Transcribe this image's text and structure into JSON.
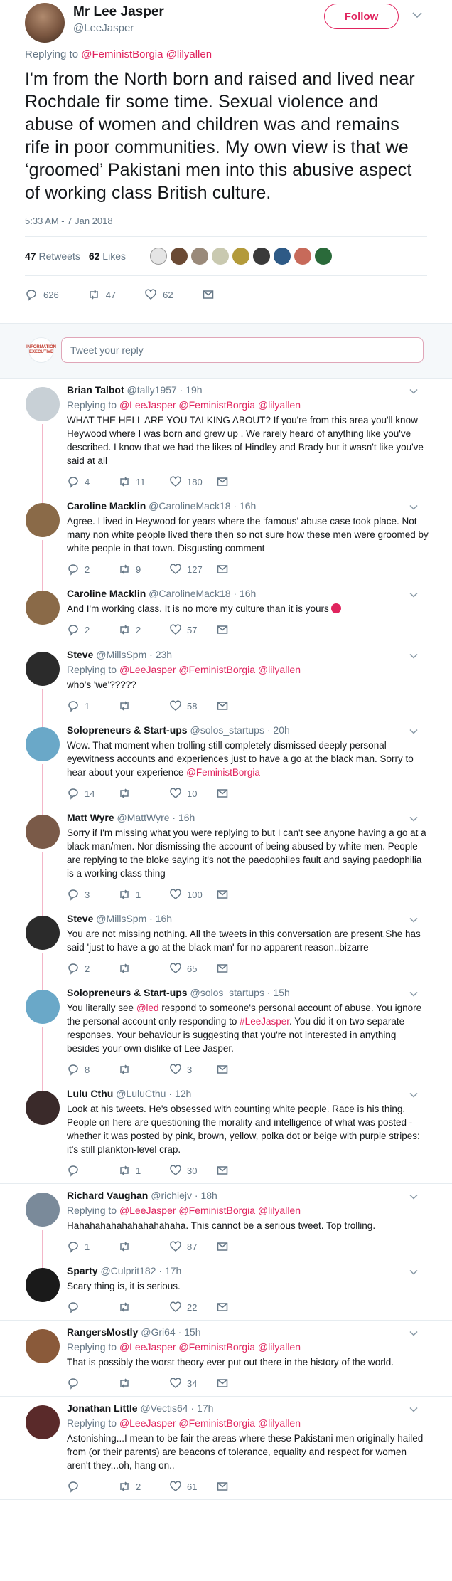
{
  "main": {
    "name": "Mr Lee Jasper",
    "handle": "@LeeJasper",
    "follow_label": "Follow",
    "replying_prefix": "Replying to",
    "replying_to": "@FeministBorgia @lilyallen",
    "text": "I'm from the North born and raised and lived near Rochdale fir some time. Sexual violence and abuse of women and children was and remains rife in poor communities. My own view is that we ‘groomed’ Pakistani men into this abusive aspect of working class British culture.",
    "time": "5:33 AM - 7 Jan 2018",
    "retweets_count": "47",
    "retweets_label": "Retweets",
    "likes_count": "62",
    "likes_label": "Likes",
    "reply_count": "626",
    "retweet_count": "47",
    "like_count": "62"
  },
  "reply_box": {
    "placeholder": "Tweet your reply",
    "avatar_text": "INFORMATION EXECUTIVE"
  },
  "colors": {
    "accent": "#e0245e",
    "thread_line": "#f3b6c8",
    "muted": "#657786"
  },
  "replies": [
    {
      "name": "Brian Talbot",
      "handle": "@tally1957",
      "time": "· 19h",
      "replying": "@LeeJasper @FeministBorgia @lilyallen",
      "text": "WHAT THE HELL ARE YOU TALKING ABOUT? If you're from this area you'll know Heywood where I was born and grew up . We rarely heard of anything like you've described. I know that we had the likes of Hindley and Brady but it wasn't like you've said at all",
      "r": "4",
      "rt": "11",
      "l": "180"
    },
    {
      "name": "Caroline Macklin",
      "handle": "@CarolineMack18",
      "time": "· 16h",
      "replying": "",
      "text": "Agree. I lived in Heywood for years where the ‘famous’ abuse case took place. Not many non white people lived there then so not sure how these men were groomed by white people in that town. Disgusting comment",
      "r": "2",
      "rt": "9",
      "l": "127"
    },
    {
      "name": "Caroline Macklin",
      "handle": "@CarolineMack18",
      "time": "· 16h",
      "replying": "",
      "text": "And I'm working class. It is no more my culture than it is yours",
      "r": "2",
      "rt": "2",
      "l": "57"
    },
    {
      "name": "Steve",
      "handle": "@MillsSpm",
      "time": "· 23h",
      "replying": "@LeeJasper @FeministBorgia @lilyallen",
      "text": "who's  'we'?????",
      "r": "1",
      "rt": "",
      "l": "58"
    },
    {
      "name": "Solopreneurs & Start-ups",
      "handle": "@solos_startups",
      "time": "· 20h",
      "replying": "",
      "text": "Wow. That moment when trolling still completely dismissed deeply personal eyewitness accounts and experiences just to have a go at the black man. Sorry to hear about your experience",
      "text_link": "@FeministBorgia",
      "r": "14",
      "rt": "",
      "l": "10"
    },
    {
      "name": "Matt Wyre",
      "handle": "@MattWyre",
      "time": "· 16h",
      "replying": "",
      "text": "Sorry if I'm missing what you were replying to but I can't see anyone having a go at a black man/men. Nor dismissing the account of being abused by white men. People are replying to the bloke saying it's not the paedophiles fault and saying paedophilia is a working class thing",
      "r": "3",
      "rt": "1",
      "l": "100"
    },
    {
      "name": "Steve",
      "handle": "@MillsSpm",
      "time": "· 16h",
      "replying": "",
      "text": "You are not missing nothing. All the tweets in this conversation are present.She has said 'just to have a go at the black man' for no apparent reason..bizarre",
      "r": "2",
      "rt": "",
      "l": "65"
    },
    {
      "name": "Solopreneurs & Start-ups",
      "handle": "@solos_startups",
      "time": "· 15h",
      "replying": "",
      "text_a": "You literally see ",
      "text_link1": "@led",
      "text_b": " respond to someone's personal account of abuse. You ignore the personal account only responding to ",
      "text_link2": "#LeeJasper",
      "text_c": ". You did it on two separate responses. Your behaviour is suggesting that you're not interested in anything besides your own dislike of Lee Jasper.",
      "r": "8",
      "rt": "",
      "l": "3"
    },
    {
      "name": "Lulu Cthu",
      "handle": "@LuluCthu",
      "time": "· 12h",
      "replying": "",
      "text": "Look at his tweets. He's obsessed with counting white people. Race is his thing. People on here are questioning the morality and intelligence of what was posted - whether it was posted by pink, brown, yellow, polka dot or beige with purple stripes: it's still plankton-level crap.",
      "r": "",
      "rt": "1",
      "l": "30"
    },
    {
      "name": "Richard Vaughan",
      "handle": "@richiejv",
      "time": "· 18h",
      "replying": "@LeeJasper @FeministBorgia @lilyallen",
      "text": "Hahahahahahahahahahaha. This cannot be a serious tweet. Top trolling.",
      "r": "1",
      "rt": "",
      "l": "87"
    },
    {
      "name": "Sparty",
      "handle": "@Culprit182",
      "time": "· 17h",
      "replying": "",
      "text": "Scary thing is, it is serious.",
      "r": "",
      "rt": "",
      "l": "22"
    },
    {
      "name": "RangersMostly",
      "handle": "@Gri64",
      "time": "· 15h",
      "replying": "@LeeJasper @FeministBorgia @lilyallen",
      "text": "That is possibly the worst theory ever put out there in the history of the world.",
      "r": "",
      "rt": "",
      "l": "34"
    },
    {
      "name": "Jonathan Little",
      "handle": "@Vectis64",
      "time": "· 17h",
      "replying": "@LeeJasper @FeministBorgia @lilyallen",
      "text": "Astonishing...I mean to be fair the areas where these Pakistani men originally hailed from (or their parents) are beacons of tolerance, equality and respect for women aren't they...oh, hang on..",
      "r": "",
      "rt": "2",
      "l": "61"
    }
  ]
}
